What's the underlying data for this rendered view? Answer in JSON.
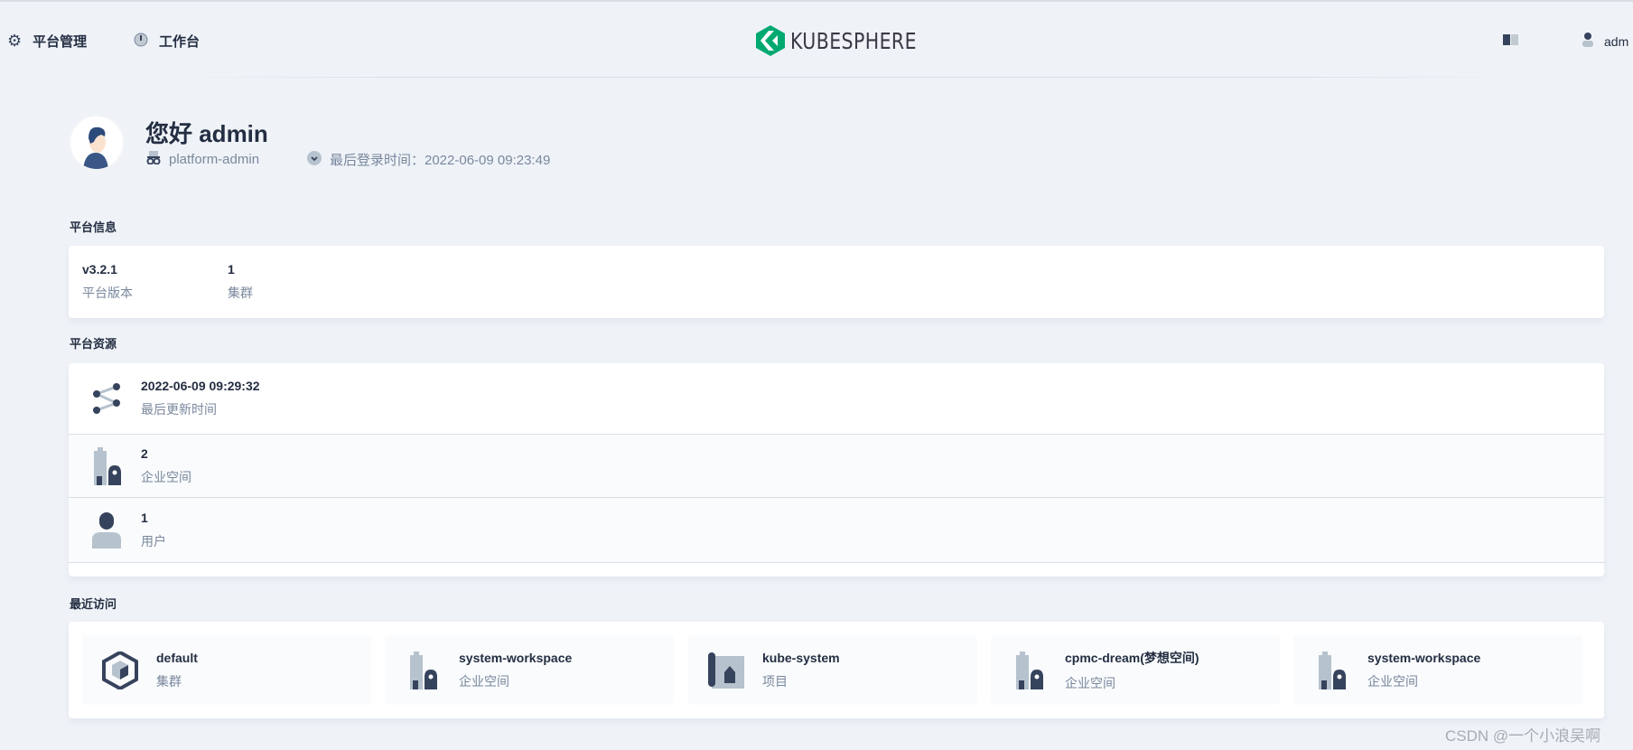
{
  "nav": {
    "platform_label": "平台管理",
    "workbench_label": "工作台",
    "user_label": "adm"
  },
  "logo": {
    "text": "KUBESPHERE",
    "color": "#00a971"
  },
  "greeting": {
    "title": "您好 admin",
    "role": "platform-admin",
    "last_login": "最后登录时间：2022-06-09 09:23:49"
  },
  "platform_info": {
    "title": "平台信息",
    "items": [
      {
        "value": "v3.2.1",
        "label": "平台版本"
      },
      {
        "value": "1",
        "label": "集群"
      }
    ]
  },
  "platform_resources": {
    "title": "平台资源",
    "items": [
      {
        "value": "2022-06-09 09:29:32",
        "label": "最后更新时间",
        "icon": "share-icon"
      },
      {
        "value": "2",
        "label": "企业空间",
        "icon": "workspace-icon"
      },
      {
        "value": "1",
        "label": "用户",
        "icon": "user-icon"
      }
    ]
  },
  "recent": {
    "title": "最近访问",
    "items": [
      {
        "name": "default",
        "type": "集群",
        "icon": "cluster-icon"
      },
      {
        "name": "system-workspace",
        "type": "企业空间",
        "icon": "workspace-icon"
      },
      {
        "name": "kube-system",
        "type": "项目",
        "icon": "project-icon"
      },
      {
        "name": "cpmc-dream(梦想空间)",
        "type": "企业空间",
        "icon": "workspace-icon"
      },
      {
        "name": "system-workspace",
        "type": "企业空间",
        "icon": "workspace-icon"
      }
    ]
  },
  "watermark": "CSDN @一个小浪吴啊"
}
